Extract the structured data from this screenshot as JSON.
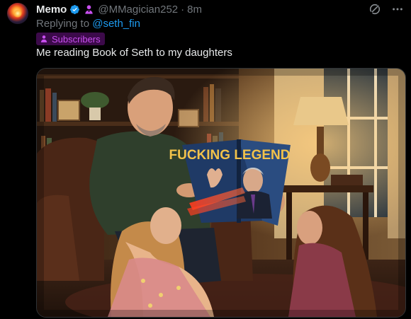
{
  "author": {
    "name": "Memo",
    "handle": "@MMagician252",
    "time": "8m",
    "verified": true,
    "verified_color": "#1d9bf0",
    "subscriber_icon": "subscriber-person-icon",
    "subscriber_color": "#c94ff0"
  },
  "reply": {
    "prefix": "Replying to ",
    "target": "@seth_fin"
  },
  "badge": {
    "label": "Subscribers",
    "icon": "subscriber-person-icon"
  },
  "tweet": {
    "text": "Me reading Book of Seth to my daughters"
  },
  "media": {
    "book_cover_text": "FUCKING LEGEND",
    "description_icons": [
      "grok-icon",
      "more-icon"
    ]
  },
  "theme": {
    "background": "#000000",
    "link": "#1d9bf0",
    "muted": "#71767b"
  }
}
